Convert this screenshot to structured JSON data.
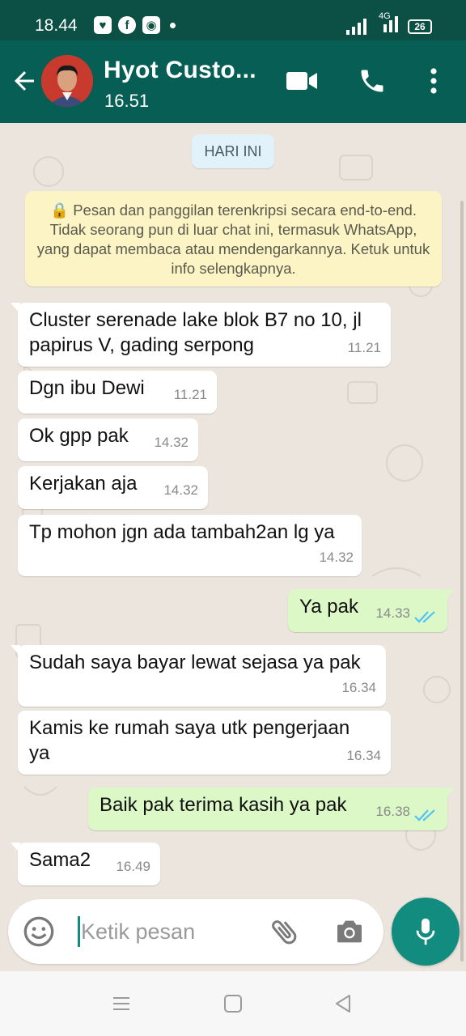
{
  "status_bar": {
    "time": "18.44",
    "network": "4G",
    "battery": "26",
    "notification_icons": [
      "app-heart-icon",
      "facebook-icon",
      "messenger-icon"
    ]
  },
  "header": {
    "contact_name": "Hyot Custo...",
    "status": "16.51",
    "accent_color": "#075e54"
  },
  "chat": {
    "date_label": "HARI INI",
    "encryption_notice": "🔒 Pesan dan panggilan terenkripsi secara end-to-end. Tidak seorang pun di luar chat ini, termasuk WhatsApp, yang dapat membaca atau mendengarkannya. Ketuk untuk info selengkapnya.",
    "messages": [
      {
        "dir": "in",
        "line1": "Cluster serenade lake blok B7 no 10, jl",
        "line2": "papirus V, gading serpong",
        "time": "11.21"
      },
      {
        "dir": "in",
        "line1": "Dgn ibu Dewi",
        "time": "11.21"
      },
      {
        "dir": "in",
        "line1": "Ok gpp pak",
        "time": "14.32"
      },
      {
        "dir": "in",
        "line1": "Kerjakan aja",
        "time": "14.32"
      },
      {
        "dir": "in",
        "line1": "Tp mohon jgn ada tambah2an lg ya",
        "time": "14.32"
      },
      {
        "dir": "out",
        "line1": "Ya pak",
        "time": "14.33",
        "status": "read"
      },
      {
        "dir": "in",
        "line1": "Sudah saya bayar lewat sejasa ya pak",
        "time": "16.34"
      },
      {
        "dir": "in",
        "line1": "Kamis ke rumah saya utk pengerjaan",
        "line2": "ya",
        "time": "16.34"
      },
      {
        "dir": "out",
        "line1": "Baik pak terima kasih ya pak",
        "time": "16.38",
        "status": "read"
      },
      {
        "dir": "in",
        "line1": "Sama2",
        "time": "16.49"
      }
    ]
  },
  "composer": {
    "placeholder": "Ketik pesan"
  },
  "colors": {
    "incoming_bubble": "#ffffff",
    "outgoing_bubble": "#dcf8c6",
    "read_ticks": "#4fc3f7",
    "fab": "#128c7e"
  }
}
